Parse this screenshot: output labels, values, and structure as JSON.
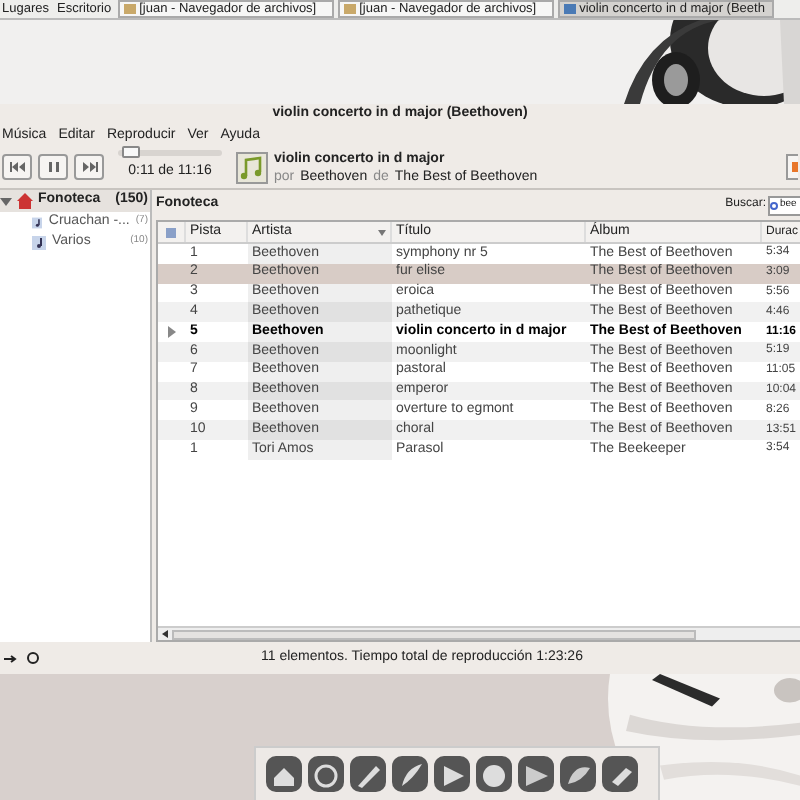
{
  "top_panel": {
    "menus": [
      "Lugares",
      "Escritorio"
    ],
    "tasks": [
      {
        "label": "[juan - Navegador de archivos]",
        "selected": false
      },
      {
        "label": "[juan - Navegador de archivos]",
        "selected": false
      },
      {
        "label": "violin concerto in d major (Beeth",
        "selected": true
      }
    ]
  },
  "window": {
    "title": "violin concerto in d major (Beethoven)",
    "menu": [
      "Música",
      "Editar",
      "Reproducir",
      "Ver",
      "Ayuda"
    ],
    "player": {
      "level": 0.07,
      "time": "0:11 de 11:16",
      "track_title": "violin concerto in d major",
      "by_label": "por",
      "artist": "Beethoven",
      "from_label": "de",
      "album": "The Best of Beethoven"
    },
    "sidebar": {
      "items": [
        {
          "label": "Fonoteca",
          "count": "(150)",
          "expanded": true,
          "selected": true,
          "children": [
            {
              "label": "Cruachan -...",
              "count": "(7)",
              "selected": false
            },
            {
              "label": "Varios",
              "count": "(10)",
              "selected": false
            }
          ]
        }
      ]
    },
    "library": {
      "title": "Fonoteca",
      "search": {
        "label": "Buscar:",
        "value": "bee"
      },
      "columns": [
        "Pista",
        "Artista",
        "Título",
        "Álbum",
        "Durac"
      ],
      "rows": [
        {
          "cells": [
            "1",
            "Beethoven",
            "symphony nr 5",
            "The Best of Beethoven",
            "5:34"
          ],
          "selected": false,
          "playing": false
        },
        {
          "cells": [
            "2",
            "Beethoven",
            "fur elise",
            "The Best of Beethoven",
            "3:09"
          ],
          "selected": true,
          "playing": false
        },
        {
          "cells": [
            "3",
            "Beethoven",
            "eroica",
            "The Best of Beethoven",
            "5:56"
          ],
          "selected": false,
          "playing": false
        },
        {
          "cells": [
            "4",
            "Beethoven",
            "pathetique",
            "The Best of Beethoven",
            "4:46"
          ],
          "selected": false,
          "playing": false
        },
        {
          "cells": [
            "5",
            "Beethoven",
            "violin concerto in d major",
            "The Best of Beethoven",
            "11:16"
          ],
          "selected": false,
          "playing": true
        },
        {
          "cells": [
            "6",
            "Beethoven",
            "moonlight",
            "The Best of Beethoven",
            "5:19"
          ],
          "selected": false,
          "playing": false
        },
        {
          "cells": [
            "7",
            "Beethoven",
            "pastoral",
            "The Best of Beethoven",
            "11:05"
          ],
          "selected": false,
          "playing": false
        },
        {
          "cells": [
            "8",
            "Beethoven",
            "emperor",
            "The Best of Beethoven",
            "10:04"
          ],
          "selected": false,
          "playing": false
        },
        {
          "cells": [
            "9",
            "Beethoven",
            "overture to egmont",
            "The Best of Beethoven",
            "8:26"
          ],
          "selected": false,
          "playing": false
        },
        {
          "cells": [
            "10",
            "Beethoven",
            "choral",
            "The Best of Beethoven",
            "13:51"
          ],
          "selected": false,
          "playing": false
        },
        {
          "cells": [
            "1",
            "Tori Amos",
            "Parasol",
            "The Beekeeper",
            "3:54"
          ],
          "selected": false,
          "playing": false
        }
      ]
    },
    "status_bar": "11 elementos. Tiempo total de reproducción 1:23:26"
  }
}
